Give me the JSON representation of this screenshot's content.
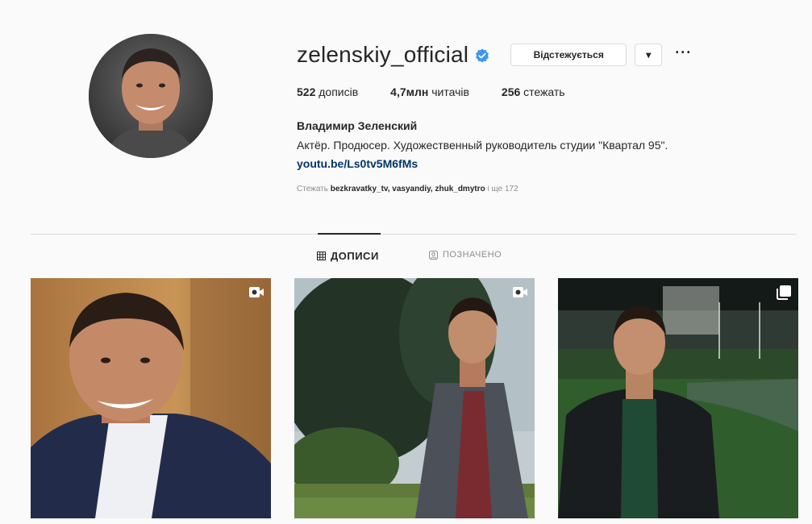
{
  "profile": {
    "username": "zelenskiy_official",
    "follow_button_label": "Відстежується",
    "dropdown_glyph": "▾",
    "more_glyph": "···",
    "icons": {
      "verified": "verified-badge-icon",
      "more": "more-options-icon"
    },
    "accent_color": "#3897f0"
  },
  "stats": {
    "posts_count": "522",
    "posts_label": "дописів",
    "followers_count": "4,7млн",
    "followers_label": "читачів",
    "following_count": "256",
    "following_label": "стежать"
  },
  "bio": {
    "full_name": "Владимир Зеленский",
    "text": "Актёр. Продюсер. Художественный руководитель студии \"Квартал 95\".",
    "link": "youtu.be/Ls0tv5M6fMs"
  },
  "followed_by": {
    "prefix": "Стежать",
    "users": [
      "bezkravatky_tv",
      "vasyandiy",
      "zhuk_dmytro"
    ],
    "separator": ", ",
    "suffix": "і ще 172"
  },
  "tabs": {
    "posts": "ДОПИСИ",
    "tagged": "ПОЗНАЧЕНО"
  },
  "posts": [
    {
      "type": "video",
      "icon": "video-icon"
    },
    {
      "type": "video",
      "icon": "video-icon"
    },
    {
      "type": "carousel",
      "icon": "carousel-icon"
    }
  ]
}
